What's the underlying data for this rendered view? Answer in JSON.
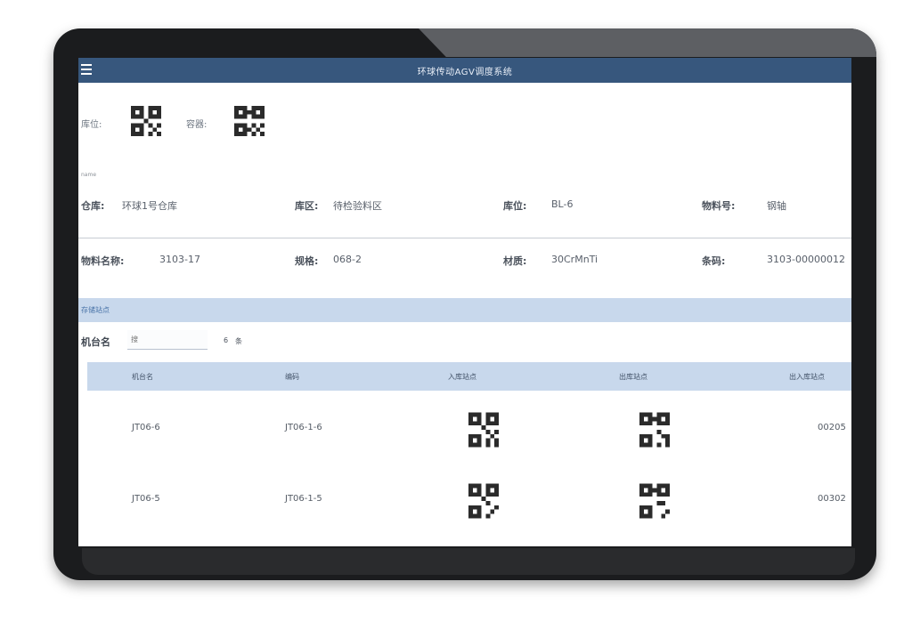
{
  "app": {
    "title": "环球传动AGV调度系统"
  },
  "scan": {
    "location_label": "库位:",
    "container_label": "容器:"
  },
  "info_small_label": "name",
  "info": [
    [
      {
        "label": "仓库:",
        "value": "环球1号仓库"
      },
      {
        "label": "库区:",
        "value": "待检验料区"
      },
      {
        "label": "库位:",
        "value": "BL-6"
      },
      {
        "label": "物料号:",
        "value": "钢轴"
      }
    ],
    [
      {
        "label": "物料名称:",
        "value": "3103-17"
      },
      {
        "label": "规格:",
        "value": "068-2"
      },
      {
        "label": "材质:",
        "value": "30CrMnTi"
      },
      {
        "label": "条码:",
        "value": "3103-00000012"
      }
    ]
  ],
  "section": {
    "title": "存储站点"
  },
  "search": {
    "label": "机台名",
    "placeholder": "搜",
    "count": "6",
    "count_unit": "条"
  },
  "table": {
    "headers": [
      "机台名",
      "编码",
      "入库站点",
      "出库站点",
      "出入库站点"
    ],
    "rows": [
      {
        "machine": "JT06-6",
        "code": "JT06-1-6",
        "station": "00205"
      },
      {
        "machine": "JT06-5",
        "code": "JT06-1-5",
        "station": "00302"
      }
    ]
  },
  "icons": {
    "menu": "hamburger-menu-icon",
    "qr": "qr-code-icon"
  },
  "colors": {
    "titlebar": "#37577d",
    "section": "#c8d8ec"
  }
}
